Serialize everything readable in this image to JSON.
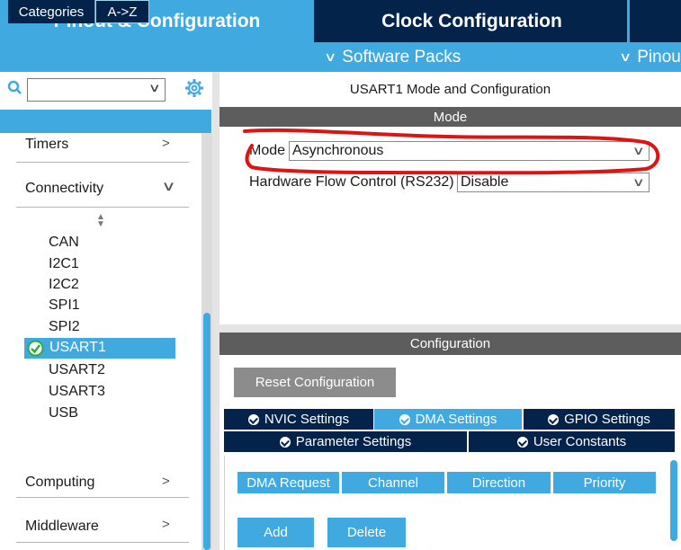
{
  "tabs": {
    "pinout": "Pinout & Configuration",
    "clock": "Clock Configuration"
  },
  "subbar": {
    "software_packs": "Software Packs",
    "pinout": "Pinout"
  },
  "sidebar": {
    "search_value": "",
    "tabs": {
      "categories": "Categories",
      "az": "A->Z"
    },
    "groups": {
      "timers": "Timers",
      "connectivity": "Connectivity",
      "computing": "Computing",
      "middleware": "Middleware"
    },
    "connectivity_items": [
      "CAN",
      "I2C1",
      "I2C2",
      "SPI1",
      "SPI2",
      "USART1",
      "USART2",
      "USART3",
      "USB"
    ],
    "selected_item": "USART1"
  },
  "mode": {
    "title": "USART1 Mode and Configuration",
    "header": "Mode",
    "mode_label": "Mode",
    "mode_value": "Asynchronous",
    "flow_label": "Hardware Flow Control (RS232)",
    "flow_value": "Disable"
  },
  "configuration": {
    "header": "Configuration",
    "reset_button": "Reset Configuration",
    "tabs": {
      "nvic": "NVIC Settings",
      "dma": "DMA Settings",
      "gpio": "GPIO Settings",
      "parameter": "Parameter Settings",
      "user_constants": "User Constants"
    },
    "active_tab": "DMA Settings",
    "dma_columns": [
      "DMA Request",
      "Channel",
      "Direction",
      "Priority"
    ],
    "add_button": "Add",
    "delete_button": "Delete"
  },
  "colors": {
    "accent": "#3fa9e0",
    "navy": "#03234b",
    "header_gray": "#5d5d5d",
    "annotation_red": "#e01212"
  }
}
